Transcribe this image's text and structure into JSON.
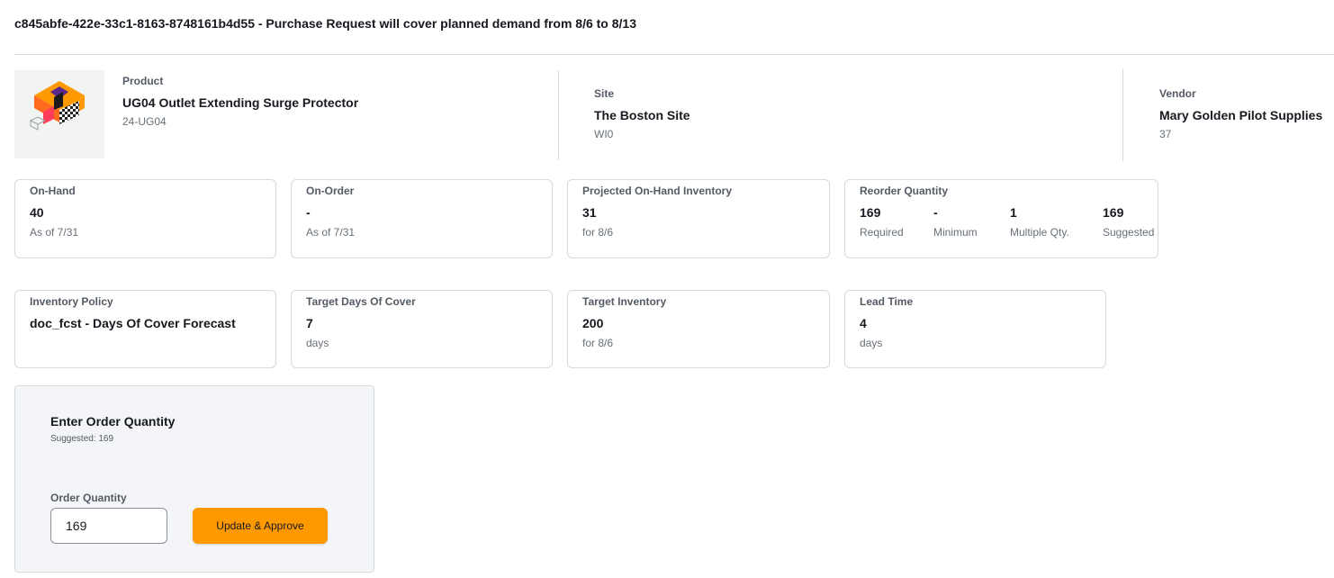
{
  "page": {
    "title": "c845abfe-422e-33c1-8163-8748161b4d55 - Purchase Request will cover planned demand from 8/6 to 8/13"
  },
  "product": {
    "label": "Product",
    "name": "UG04 Outlet Extending Surge Protector",
    "sku": "24-UG04",
    "image_icon": "product-box-icon"
  },
  "site": {
    "label": "Site",
    "name": "The Boston Site",
    "code": "WI0"
  },
  "vendor": {
    "label": "Vendor",
    "name": "Mary Golden Pilot Supplies",
    "code": "37"
  },
  "metrics_row1": {
    "on_hand": {
      "label": "On-Hand",
      "value": "40",
      "sub": "As of 7/31"
    },
    "on_order": {
      "label": "On-Order",
      "value": "-",
      "sub": "As of 7/31"
    },
    "projected": {
      "label": "Projected On-Hand Inventory",
      "value": "31",
      "sub": "for 8/6"
    },
    "reorder": {
      "label": "Reorder Quantity",
      "cells": [
        {
          "value": "169",
          "caption": "Required"
        },
        {
          "value": "-",
          "caption": "Minimum"
        },
        {
          "value": "1",
          "caption": "Multiple Qty."
        },
        {
          "value": "169",
          "caption": "Suggested"
        }
      ]
    }
  },
  "metrics_row2": {
    "policy": {
      "label": "Inventory Policy",
      "value": "doc_fcst - Days Of Cover Forecast"
    },
    "target_days": {
      "label": "Target Days Of Cover",
      "value": "7",
      "sub": "days"
    },
    "target_inventory": {
      "label": "Target Inventory",
      "value": "200",
      "sub": "for 8/6"
    },
    "lead_time": {
      "label": "Lead Time",
      "value": "4",
      "sub": "days"
    }
  },
  "order": {
    "heading": "Enter Order Quantity",
    "suggested": "Suggested: 169",
    "field_label": "Order Quantity",
    "quantity_value": "169",
    "button_label": "Update & Approve"
  },
  "colors": {
    "accent": "#ff9900",
    "panel_bg": "#f4f5f8",
    "border": "#d5dbdb"
  }
}
